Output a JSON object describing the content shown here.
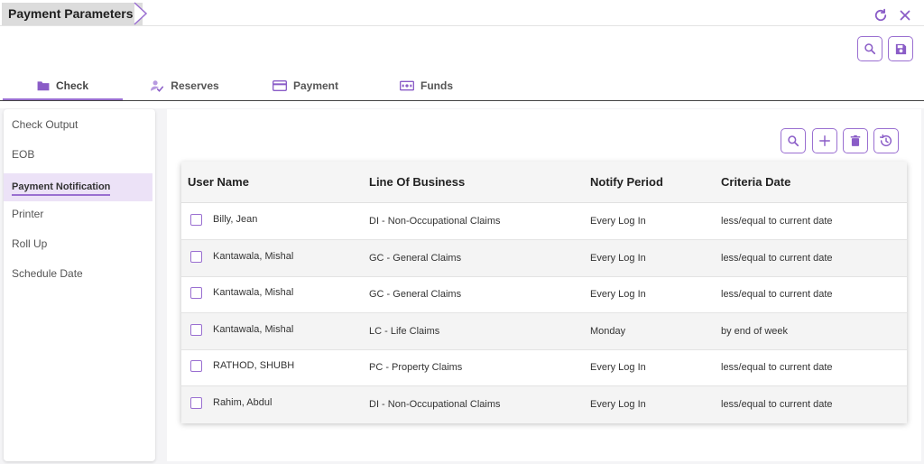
{
  "header": {
    "title": "Payment Parameters"
  },
  "tabs": [
    {
      "label": "Check",
      "icon": "folder-icon",
      "active": true
    },
    {
      "label": "Reserves",
      "icon": "user-check-icon",
      "active": false
    },
    {
      "label": "Payment",
      "icon": "credit-card-icon",
      "active": false
    },
    {
      "label": "Funds",
      "icon": "money-icon",
      "active": false
    }
  ],
  "sidebar": {
    "items": [
      {
        "label": "Check Output"
      },
      {
        "label": "EOB"
      },
      {
        "label": "Payment Notification",
        "active": true
      },
      {
        "label": "Printer"
      },
      {
        "label": "Roll Up"
      },
      {
        "label": "Schedule Date"
      }
    ]
  },
  "table": {
    "columns": [
      "User Name",
      "Line Of Business",
      "Notify Period",
      "Criteria Date"
    ],
    "rows": [
      [
        "Billy, Jean",
        "DI - Non-Occupational Claims",
        "Every Log In",
        "less/equal to current date"
      ],
      [
        "Kantawala, Mishal",
        "GC - General Claims",
        "Every Log In",
        "less/equal to current date"
      ],
      [
        "Kantawala, Mishal",
        "GC - General Claims",
        "Every Log In",
        "less/equal to current date"
      ],
      [
        "Kantawala, Mishal",
        "LC - Life Claims",
        "Monday",
        "by end of week"
      ],
      [
        "RATHOD, SHUBH",
        "PC - Property Claims",
        "Every Log In",
        "less/equal to current date"
      ],
      [
        "Rahim, Abdul",
        "DI - Non-Occupational Claims",
        "Every Log In",
        "less/equal to current date"
      ]
    ]
  },
  "colors": {
    "accent": "#9a6fd1",
    "active_item_bg": "#ece2f7",
    "tab_underline": "#9a6fd1"
  }
}
